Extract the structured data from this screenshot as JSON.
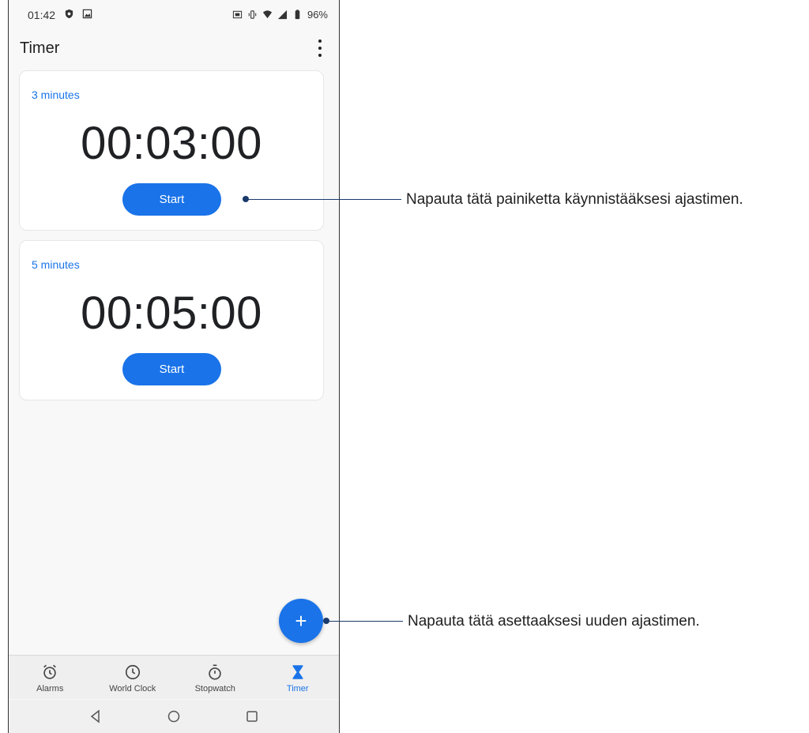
{
  "status_bar": {
    "time": "01:42",
    "battery": "96%"
  },
  "app_bar": {
    "title": "Timer"
  },
  "timers": [
    {
      "label": "3 minutes",
      "time": "00:03:00",
      "button": "Start"
    },
    {
      "label": "5 minutes",
      "time": "00:05:00",
      "button": "Start"
    }
  ],
  "fab": {
    "label": "+"
  },
  "bottom_nav": {
    "items": [
      {
        "label": "Alarms",
        "icon": "alarm-icon"
      },
      {
        "label": "World Clock",
        "icon": "clock-icon"
      },
      {
        "label": "Stopwatch",
        "icon": "stopwatch-icon"
      },
      {
        "label": "Timer",
        "icon": "hourglass-icon",
        "active": true
      }
    ]
  },
  "callouts": [
    {
      "text": "Napauta tätä painiketta käynnistääksesi ajastimen."
    },
    {
      "text": "Napauta tätä asettaaksesi uuden ajastimen."
    }
  ],
  "colors": {
    "accent": "#1a73e8",
    "callout": "#1a3a6b"
  }
}
